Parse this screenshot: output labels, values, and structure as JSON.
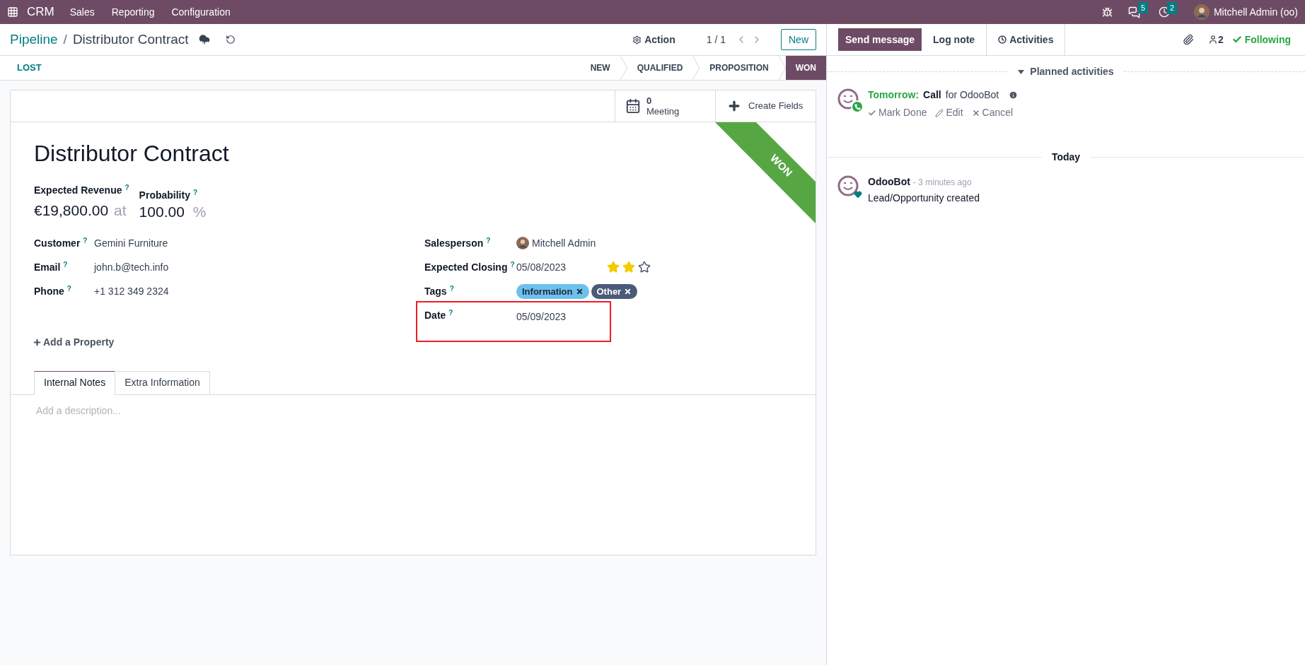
{
  "navbar": {
    "app": "CRM",
    "menus": [
      "Sales",
      "Reporting",
      "Configuration"
    ],
    "messages_count": "5",
    "activities_count": "2",
    "user": "Mitchell Admin (oo)"
  },
  "control_panel": {
    "breadcrumb": "Pipeline",
    "separator": "/",
    "record": "Distributor Contract",
    "action": "Action",
    "pager": "1 / 1",
    "new_button": "New"
  },
  "statusbar": {
    "lost_button": "LOST",
    "stages": [
      {
        "label": "NEW",
        "selected": false
      },
      {
        "label": "QUALIFIED",
        "selected": false
      },
      {
        "label": "PROPOSITION",
        "selected": false
      },
      {
        "label": "WON",
        "selected": true
      }
    ]
  },
  "button_box": {
    "meeting_count": "0",
    "meeting_label": "Meeting",
    "create_fields": "Create Fields"
  },
  "ribbon": "WON",
  "title": "Distributor Contract",
  "revenue": {
    "label": "Expected Revenue",
    "help": "?",
    "value": "€19,800.00",
    "at": "at",
    "probability_label": "Probability",
    "probability_help": "?",
    "probability": "100.00",
    "percent": "%"
  },
  "left_fields": [
    {
      "label": "Customer",
      "help": "?",
      "value": "Gemini Furniture"
    },
    {
      "label": "Email",
      "help": "?",
      "value": "john.b@tech.info"
    },
    {
      "label": "Phone",
      "help": "?",
      "value": "+1 312 349 2324"
    }
  ],
  "right_fields": [
    {
      "kind": "user",
      "label": "Salesperson",
      "help": "?",
      "value": "Mitchell Admin",
      "highlighted": false
    },
    {
      "kind": "date_stars",
      "label": "Expected Closing",
      "help": "?",
      "value": "05/08/2023",
      "stars": 2,
      "highlighted": false
    },
    {
      "kind": "tags",
      "label": "Tags",
      "help": "?",
      "tags": [
        {
          "label": "Information",
          "color": "#6cc1ed"
        },
        {
          "label": "Other",
          "color": "#4c5a7a"
        }
      ],
      "highlighted": false
    },
    {
      "kind": "text",
      "label": "Date",
      "help": "?",
      "value": "05/09/2023",
      "highlighted": true
    }
  ],
  "add_property": "Add a Property",
  "tabs": [
    {
      "label": "Internal Notes",
      "selected": true
    },
    {
      "label": "Extra Information",
      "selected": false
    }
  ],
  "description": {
    "placeholder": "Add a description..."
  },
  "chatter": {
    "buttons": [
      {
        "label": "Send message",
        "kind": "primary"
      },
      {
        "label": "Log note",
        "kind": "plain"
      },
      {
        "label": "Activities",
        "kind": "tab"
      }
    ],
    "followers": "2",
    "following": "Following",
    "planned_title": "Planned activities",
    "activity": {
      "when": "Tomorrow:",
      "type": "Call",
      "for": "for OdooBot",
      "actions": [
        "Mark Done",
        "Edit",
        "Cancel"
      ]
    },
    "date_separator": "Today",
    "messages": [
      {
        "author": "OdooBot",
        "time": "- 3 minutes ago",
        "body": "Lead/Opportunity created"
      }
    ]
  }
}
